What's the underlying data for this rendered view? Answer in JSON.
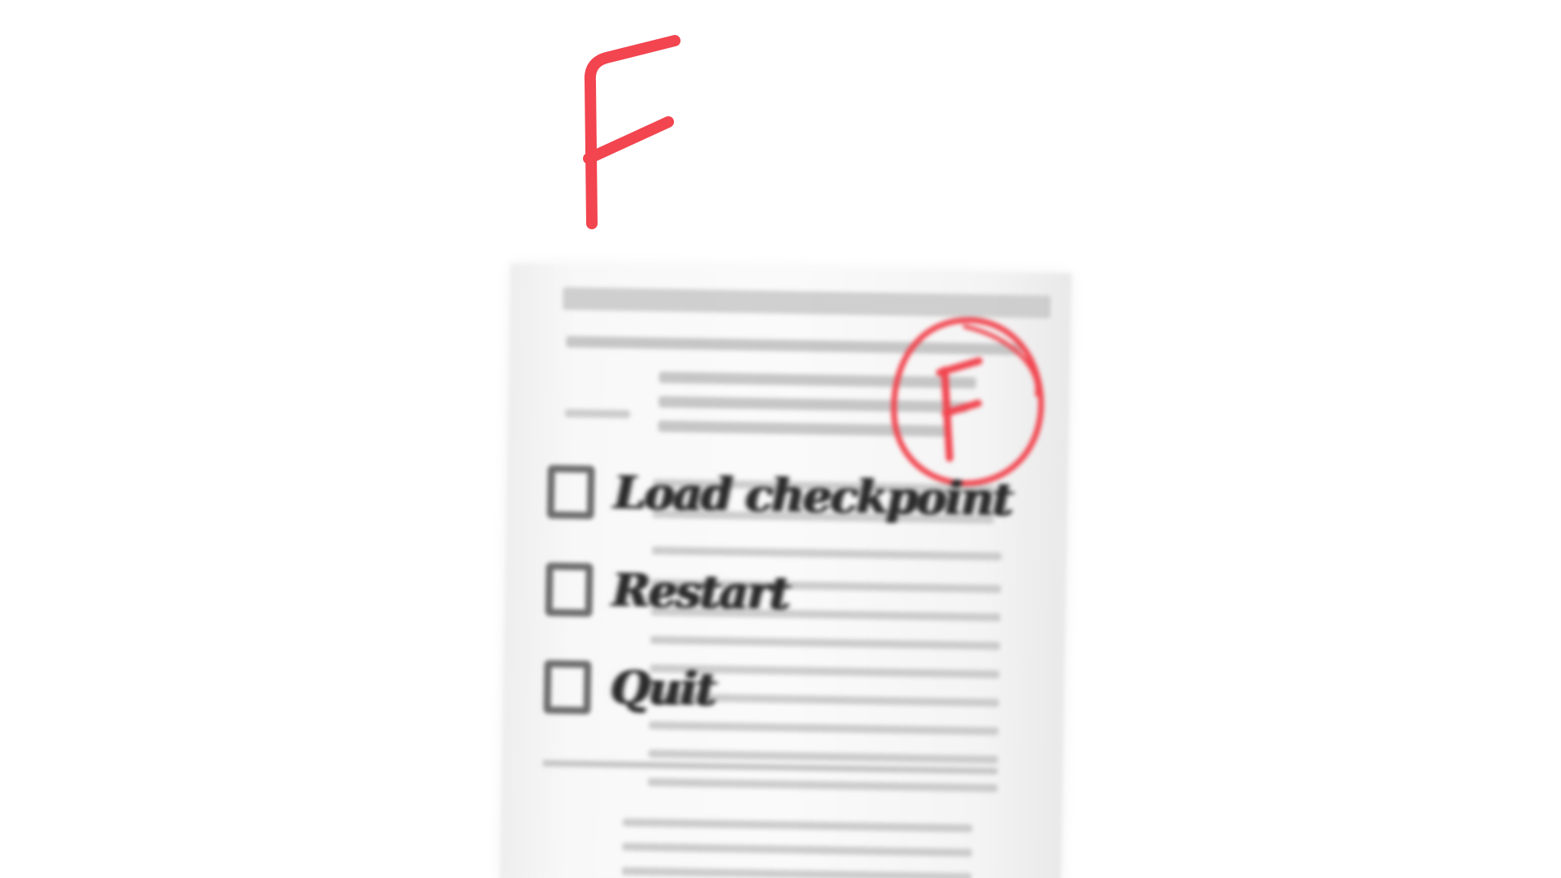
{
  "grade": {
    "letter": "F",
    "color": "#f2454f"
  },
  "paper": {
    "stamp_letter": "F",
    "stamp_color": "#f2454f",
    "menu_options": [
      {
        "label": "Load checkpoint"
      },
      {
        "label": "Restart"
      },
      {
        "label": "Quit"
      }
    ]
  }
}
